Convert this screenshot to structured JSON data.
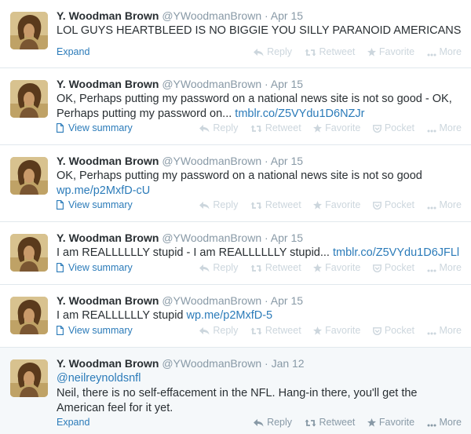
{
  "tweets": [
    {
      "fullname": "Y. Woodman Brown",
      "handle": "@YWoodmanBrown",
      "dot": "·",
      "time": "Apr 15",
      "mention": "",
      "text": "LOL GUYS HEARTBLEED IS NO BIGGIE YOU SILLY PARANOID AMERICANS",
      "link": "",
      "footer_link": "Expand",
      "actions": {
        "reply": "Reply",
        "retweet": "Retweet",
        "favorite": "Favorite",
        "more": "More"
      }
    },
    {
      "fullname": "Y. Woodman Brown",
      "handle": "@YWoodmanBrown",
      "dot": "·",
      "time": "Apr 15",
      "mention": "",
      "text": "OK, Perhaps putting my password on a national news site is not so good - OK, Perhaps putting my password on... ",
      "link": "tmblr.co/Z5VYdu1D6NZJr",
      "footer_link": "View summary",
      "actions": {
        "reply": "Reply",
        "retweet": "Retweet",
        "favorite": "Favorite",
        "pocket": "Pocket",
        "more": "More"
      }
    },
    {
      "fullname": "Y. Woodman Brown",
      "handle": "@YWoodmanBrown",
      "dot": "·",
      "time": "Apr 15",
      "mention": "",
      "text": "OK, Perhaps putting my password on a national news site is not so good ",
      "link": "wp.me/p2MxfD-cU",
      "footer_link": "View summary",
      "actions": {
        "reply": "Reply",
        "retweet": "Retweet",
        "favorite": "Favorite",
        "pocket": "Pocket",
        "more": "More"
      }
    },
    {
      "fullname": "Y. Woodman Brown",
      "handle": "@YWoodmanBrown",
      "dot": "·",
      "time": "Apr 15",
      "mention": "",
      "text": "I am REALLLLLLY stupid - I am REALLLLLLY stupid... ",
      "link": "tmblr.co/Z5VYdu1D6JFLl",
      "footer_link": "View summary",
      "actions": {
        "reply": "Reply",
        "retweet": "Retweet",
        "favorite": "Favorite",
        "pocket": "Pocket",
        "more": "More"
      }
    },
    {
      "fullname": "Y. Woodman Brown",
      "handle": "@YWoodmanBrown",
      "dot": "·",
      "time": "Apr 15",
      "mention": "",
      "text": "I am REALLLLLLY stupid ",
      "link": "wp.me/p2MxfD-5",
      "footer_link": "View summary",
      "actions": {
        "reply": "Reply",
        "retweet": "Retweet",
        "favorite": "Favorite",
        "pocket": "Pocket",
        "more": "More"
      }
    },
    {
      "fullname": "Y. Woodman Brown",
      "handle": "@YWoodmanBrown",
      "dot": "·",
      "time": "Jan 12",
      "mention": "@neilreynoldsnfl",
      "text": "Neil, there is no self-effacement in the NFL.  Hang-in there, you'll get the American feel for it yet.",
      "link": "",
      "footer_link": "Expand",
      "actions": {
        "reply": "Reply",
        "retweet": "Retweet",
        "favorite": "Favorite",
        "more": "More"
      }
    }
  ],
  "colors": {
    "link": "#2b7bb9",
    "muted": "#8899a6",
    "action_faded": "#ccd6dd",
    "divider": "#e1e8ed",
    "highlight_bg": "#f5f8fa"
  },
  "icons": [
    "reply-icon",
    "retweet-icon",
    "favorite-star-icon",
    "pocket-icon",
    "more-dots-icon",
    "document-icon"
  ]
}
